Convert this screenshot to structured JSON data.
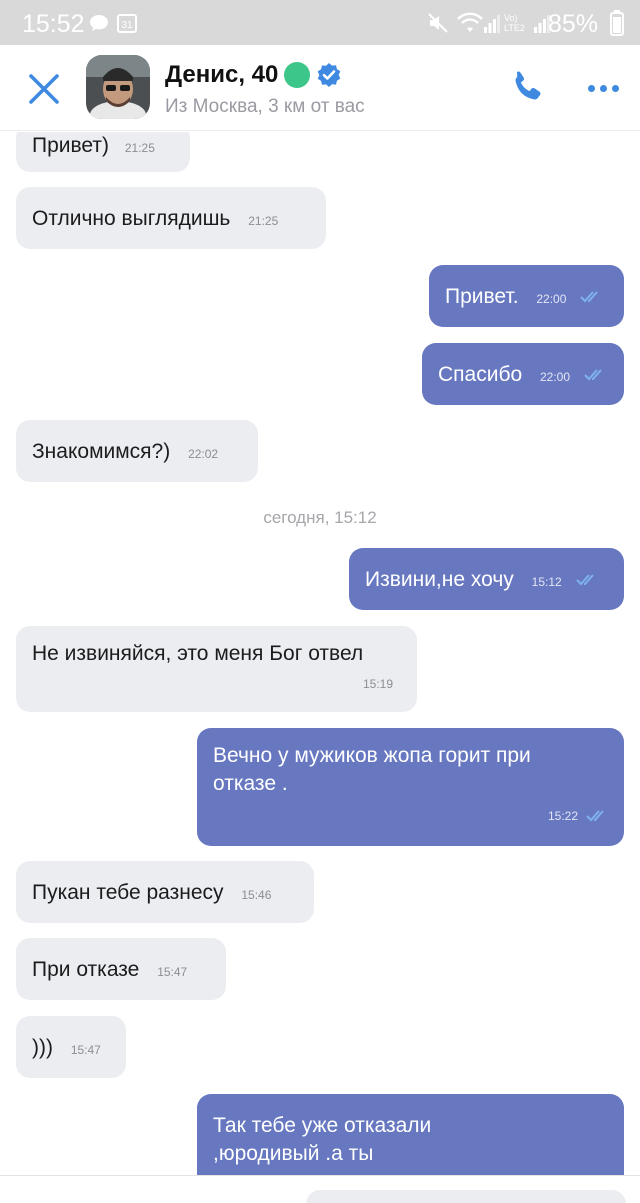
{
  "status_bar": {
    "time": "15:52",
    "battery": "85%",
    "network_label": "Vo) LTE2",
    "icons": [
      "chat-bubble-icon",
      "calendar-icon",
      "mute-icon",
      "wifi-icon",
      "signal-icon",
      "signal-icon",
      "battery-icon"
    ]
  },
  "header": {
    "name": "Денис, 40",
    "subtitle": "Из Москва, 3 км от вас",
    "colors": {
      "accent": "#3f8ae0",
      "online": "#3cc68a",
      "verified": "#3f8ae0"
    }
  },
  "messages": [
    {
      "dir": "in",
      "text": "Привет)",
      "time": "21:25"
    },
    {
      "dir": "in",
      "text": "Отлично выглядишь",
      "time": "21:25"
    },
    {
      "dir": "out",
      "text": "Привет.",
      "time": "22:00"
    },
    {
      "dir": "out",
      "text": "Спасибо",
      "time": "22:00"
    },
    {
      "dir": "in",
      "text": "Знакомимся?)",
      "time": "22:02"
    },
    {
      "dir": "out",
      "text": "Извини,не хочу",
      "time": "15:12"
    },
    {
      "dir": "in",
      "text": "Не извиняйся, это меня Бог отвел",
      "time": "15:19"
    },
    {
      "dir": "out",
      "text": "Вечно у мужиков жопа горит при отказе .",
      "time": "15:22"
    },
    {
      "dir": "in",
      "text": "Пукан тебе разнесу",
      "time": "15:46"
    },
    {
      "dir": "in",
      "text": "При отказе",
      "time": "15:47"
    },
    {
      "dir": "in",
      "text": ")))",
      "time": "15:47"
    },
    {
      "dir": "out",
      "text": "Так тебе уже отказали ,юродивый .а ты",
      "time": ""
    }
  ],
  "date_separator": "сегодня, 15:12",
  "colors": {
    "incoming_bubble": "#ebedf0",
    "outgoing_bubble": "#6778c0",
    "tick": "#7fb2ee"
  }
}
